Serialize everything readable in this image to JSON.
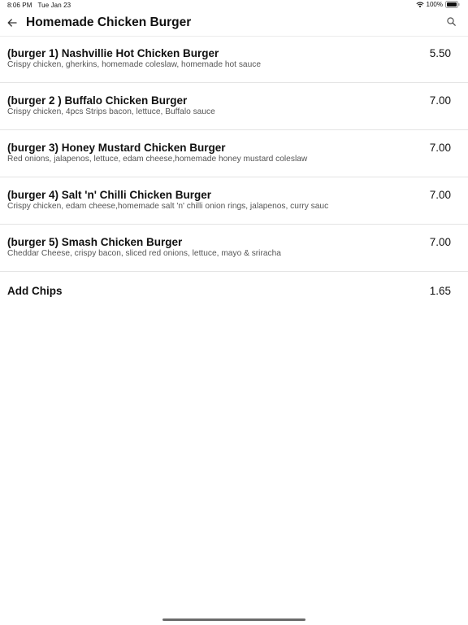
{
  "status_bar": {
    "time": "8:06 PM",
    "date": "Tue Jan 23",
    "battery": "100%"
  },
  "nav": {
    "title": "Homemade Chicken Burger",
    "back_icon": "arrow-left-icon",
    "search_icon": "search-icon"
  },
  "items": [
    {
      "name": "(burger 1) Nashvillie Hot Chicken Burger",
      "description": "Crispy chicken, gherkins, homemade coleslaw, homemade hot sauce",
      "price": "5.50"
    },
    {
      "name": "(burger 2 ) Buffalo Chicken Burger",
      "description": "Crispy chicken, 4pcs Strips bacon, lettuce, Buffalo sauce",
      "price": "7.00"
    },
    {
      "name": "(burger 3) Honey Mustard Chicken Burger",
      "description": "Red onions, jalapenos, lettuce, edam cheese,homemade honey mustard coleslaw",
      "price": "7.00"
    },
    {
      "name": "(burger 4) Salt 'n' Chilli Chicken Burger",
      "description": "Crispy chicken, edam cheese,homemade salt 'n' chilli onion rings, jalapenos, curry sauc",
      "price": "7.00"
    },
    {
      "name": "(burger 5) Smash Chicken Burger",
      "description": "Cheddar Cheese, crispy bacon, sliced red onions, lettuce, mayo & sriracha",
      "price": "7.00"
    },
    {
      "name": "Add Chips",
      "description": "",
      "price": "1.65"
    }
  ]
}
